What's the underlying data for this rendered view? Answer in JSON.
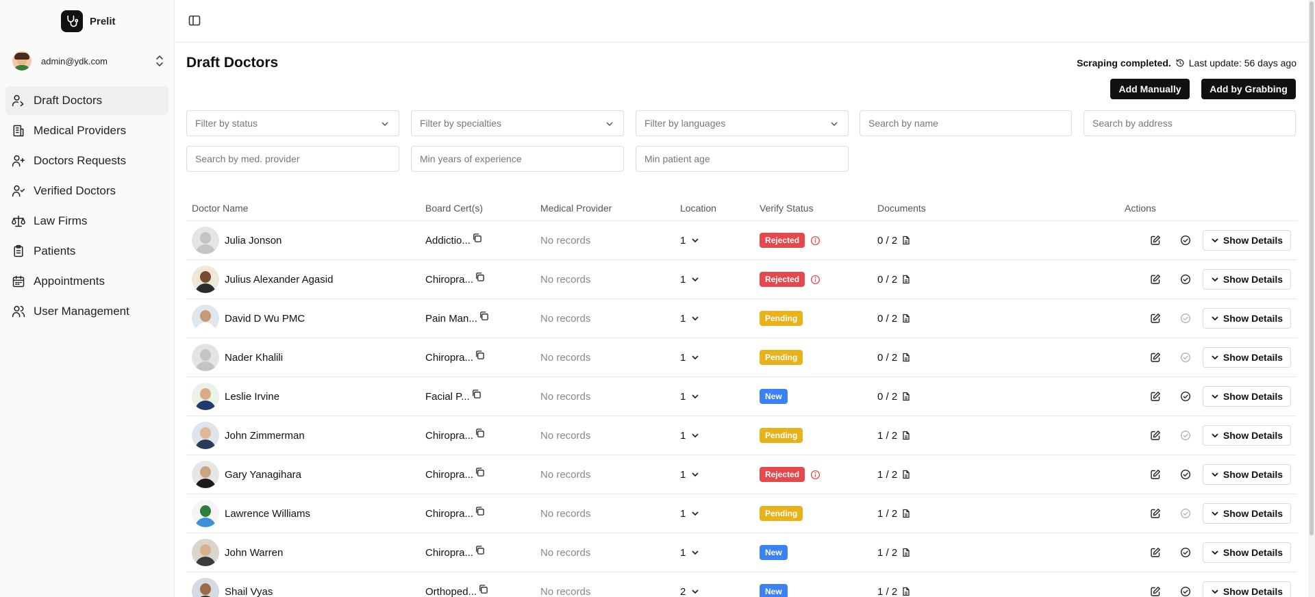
{
  "brand": {
    "name": "Prelit"
  },
  "user": {
    "email": "admin@ydk.com"
  },
  "sidebar": {
    "items": [
      {
        "label": "Draft Doctors",
        "icon": "user-edit-icon",
        "active": true
      },
      {
        "label": "Medical Providers",
        "icon": "hospital-icon",
        "active": false
      },
      {
        "label": "Doctors Requests",
        "icon": "user-plus-icon",
        "active": false
      },
      {
        "label": "Verified Doctors",
        "icon": "user-check-icon",
        "active": false
      },
      {
        "label": "Law Firms",
        "icon": "scale-icon",
        "active": false
      },
      {
        "label": "Patients",
        "icon": "clipboard-icon",
        "active": false
      },
      {
        "label": "Appointments",
        "icon": "calendar-icon",
        "active": false
      },
      {
        "label": "User Management",
        "icon": "users-icon",
        "active": false
      }
    ]
  },
  "page": {
    "title": "Draft Doctors",
    "scrape_status": "Scraping completed.",
    "last_update": "Last update: 56 days ago",
    "add_manually": "Add Manually",
    "add_by_grabbing": "Add by Grabbing"
  },
  "filters": {
    "status": "Filter by status",
    "specialties": "Filter by specialties",
    "languages": "Filter by languages",
    "name": "Search by name",
    "address": "Search by address",
    "med_provider": "Search by med. provider",
    "min_years": "Min years of experience",
    "min_age": "Min patient age"
  },
  "table": {
    "headers": {
      "name": "Doctor Name",
      "cert": "Board Cert(s)",
      "provider": "Medical Provider",
      "location": "Location",
      "status": "Verify Status",
      "documents": "Documents",
      "actions": "Actions"
    },
    "show_details": "Show Details",
    "rows": [
      {
        "name": "Julia Jonson",
        "cert": "Addictio...",
        "provider": "No records",
        "location": "1",
        "status": "Rejected",
        "docs": "0 / 2"
      },
      {
        "name": "Julius Alexander Agasid",
        "cert": "Chiropra...",
        "provider": "No records",
        "location": "1",
        "status": "Rejected",
        "docs": "0 / 2"
      },
      {
        "name": "David D Wu PMC",
        "cert": "Pain Man...",
        "provider": "No records",
        "location": "1",
        "status": "Pending",
        "docs": "0 / 2"
      },
      {
        "name": "Nader Khalili",
        "cert": "Chiropra...",
        "provider": "No records",
        "location": "1",
        "status": "Pending",
        "docs": "0 / 2"
      },
      {
        "name": "Leslie Irvine",
        "cert": "Facial P...",
        "provider": "No records",
        "location": "1",
        "status": "New",
        "docs": "0 / 2"
      },
      {
        "name": "John Zimmerman",
        "cert": "Chiropra...",
        "provider": "No records",
        "location": "1",
        "status": "Pending",
        "docs": "1 / 2"
      },
      {
        "name": "Gary Yanagihara",
        "cert": "Chiropra...",
        "provider": "No records",
        "location": "1",
        "status": "Rejected",
        "docs": "1 / 2"
      },
      {
        "name": "Lawrence Williams",
        "cert": "Chiropra...",
        "provider": "No records",
        "location": "1",
        "status": "Pending",
        "docs": "1 / 2"
      },
      {
        "name": "John Warren",
        "cert": "Chiropra...",
        "provider": "No records",
        "location": "1",
        "status": "New",
        "docs": "1 / 2"
      },
      {
        "name": "Shail Vyas",
        "cert": "Orthoped...",
        "provider": "No records",
        "location": "2",
        "status": "New",
        "docs": "1 / 2"
      }
    ]
  },
  "colors": {
    "rejected": "#e5484d",
    "pending": "#e8b21a",
    "new": "#3b82f6",
    "dark": "#111111"
  }
}
